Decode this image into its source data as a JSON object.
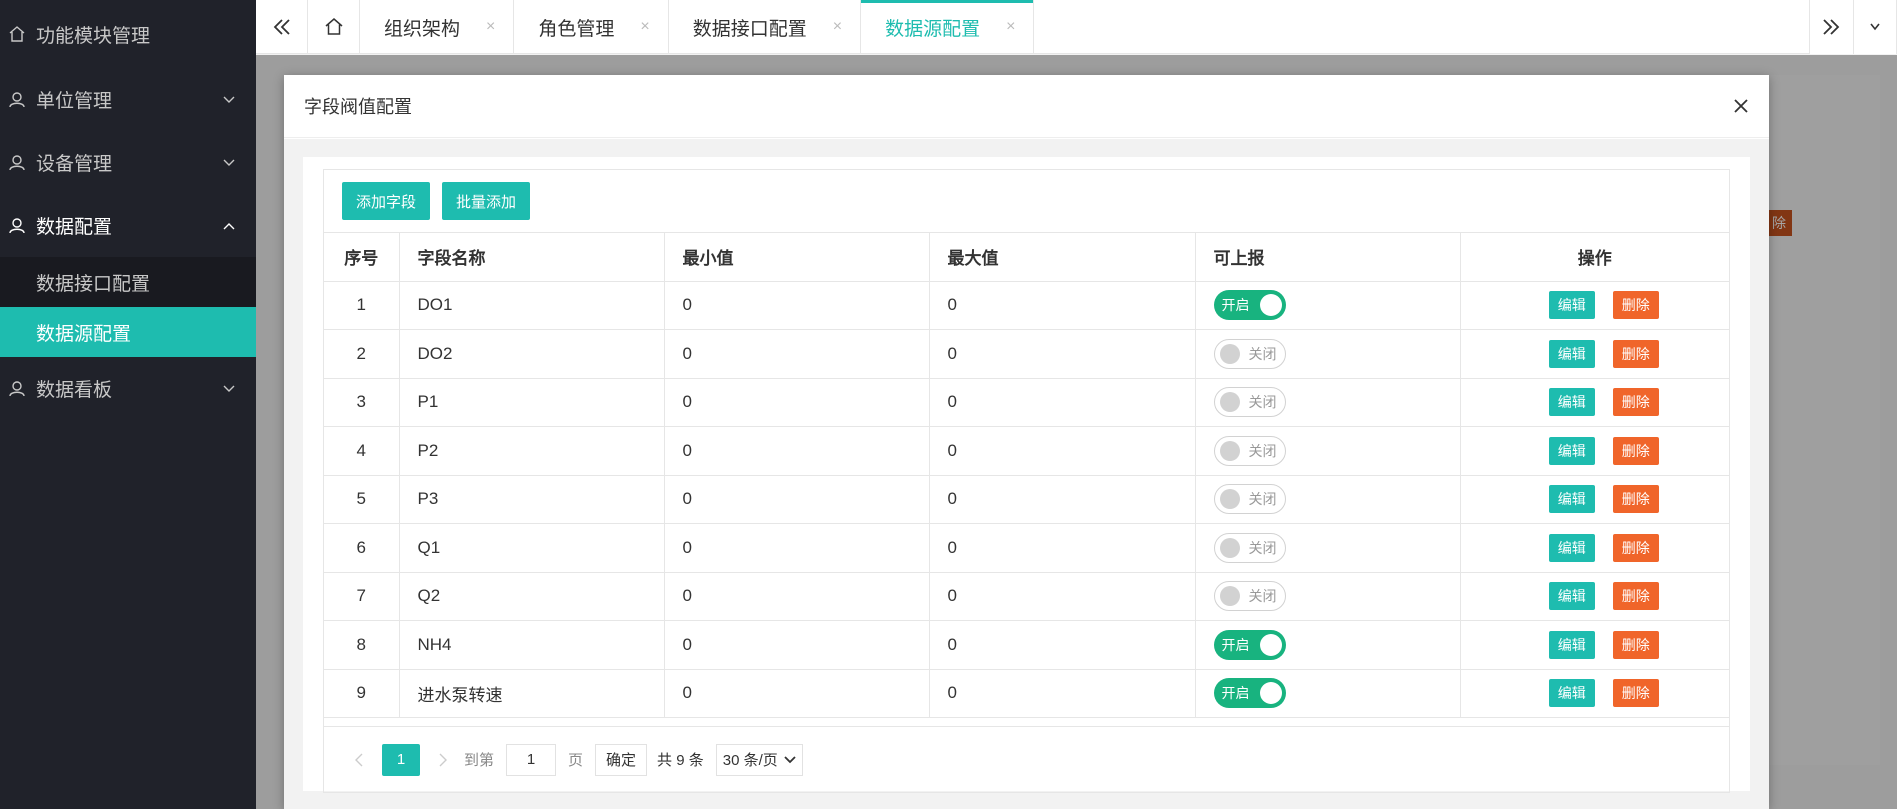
{
  "sidebar": {
    "top_item": "功能模块管理",
    "groups": [
      {
        "label": "单位管理",
        "expanded": false
      },
      {
        "label": "设备管理",
        "expanded": false
      },
      {
        "label": "数据配置",
        "expanded": true
      },
      {
        "label": "数据看板",
        "expanded": false
      }
    ],
    "sub_items": [
      "数据接口配置",
      "数据源配置"
    ],
    "active_sub": "数据源配置"
  },
  "tabs": [
    {
      "label": "组织架构",
      "active": false
    },
    {
      "label": "角色管理",
      "active": false
    },
    {
      "label": "数据接口配置",
      "active": false
    },
    {
      "label": "数据源配置",
      "active": true
    }
  ],
  "tab_close": "×",
  "background": {
    "badge": "除"
  },
  "modal": {
    "title": "字段阀值配置",
    "add_field_label": "添加字段",
    "batch_add_label": "批量添加",
    "columns": [
      "序号",
      "字段名称",
      "最小值",
      "最大值",
      "可上报",
      "操作"
    ],
    "rows": [
      {
        "index": "1",
        "name": "DO1",
        "min": "0",
        "max": "0",
        "report": true
      },
      {
        "index": "2",
        "name": "DO2",
        "min": "0",
        "max": "0",
        "report": false
      },
      {
        "index": "3",
        "name": "P1",
        "min": "0",
        "max": "0",
        "report": false
      },
      {
        "index": "4",
        "name": "P2",
        "min": "0",
        "max": "0",
        "report": false
      },
      {
        "index": "5",
        "name": "P3",
        "min": "0",
        "max": "0",
        "report": false
      },
      {
        "index": "6",
        "name": "Q1",
        "min": "0",
        "max": "0",
        "report": false
      },
      {
        "index": "7",
        "name": "Q2",
        "min": "0",
        "max": "0",
        "report": false
      },
      {
        "index": "8",
        "name": "NH4",
        "min": "0",
        "max": "0",
        "report": true
      },
      {
        "index": "9",
        "name": "进水泵转速",
        "min": "0",
        "max": "0",
        "report": true
      }
    ],
    "switch_on_label": "开启",
    "switch_off_label": "关闭",
    "edit_label": "编辑",
    "delete_label": "删除"
  },
  "pager": {
    "current_page": "1",
    "goto_label": "到第",
    "goto_value": "1",
    "page_unit": "页",
    "confirm_label": "确定",
    "total": "共 9 条",
    "page_size": "30 条/页"
  },
  "colors": {
    "accent": "#1ebcaf",
    "switch_on": "#18b37f",
    "danger": "#f0652a",
    "sidebar_bg": "#20222a"
  }
}
